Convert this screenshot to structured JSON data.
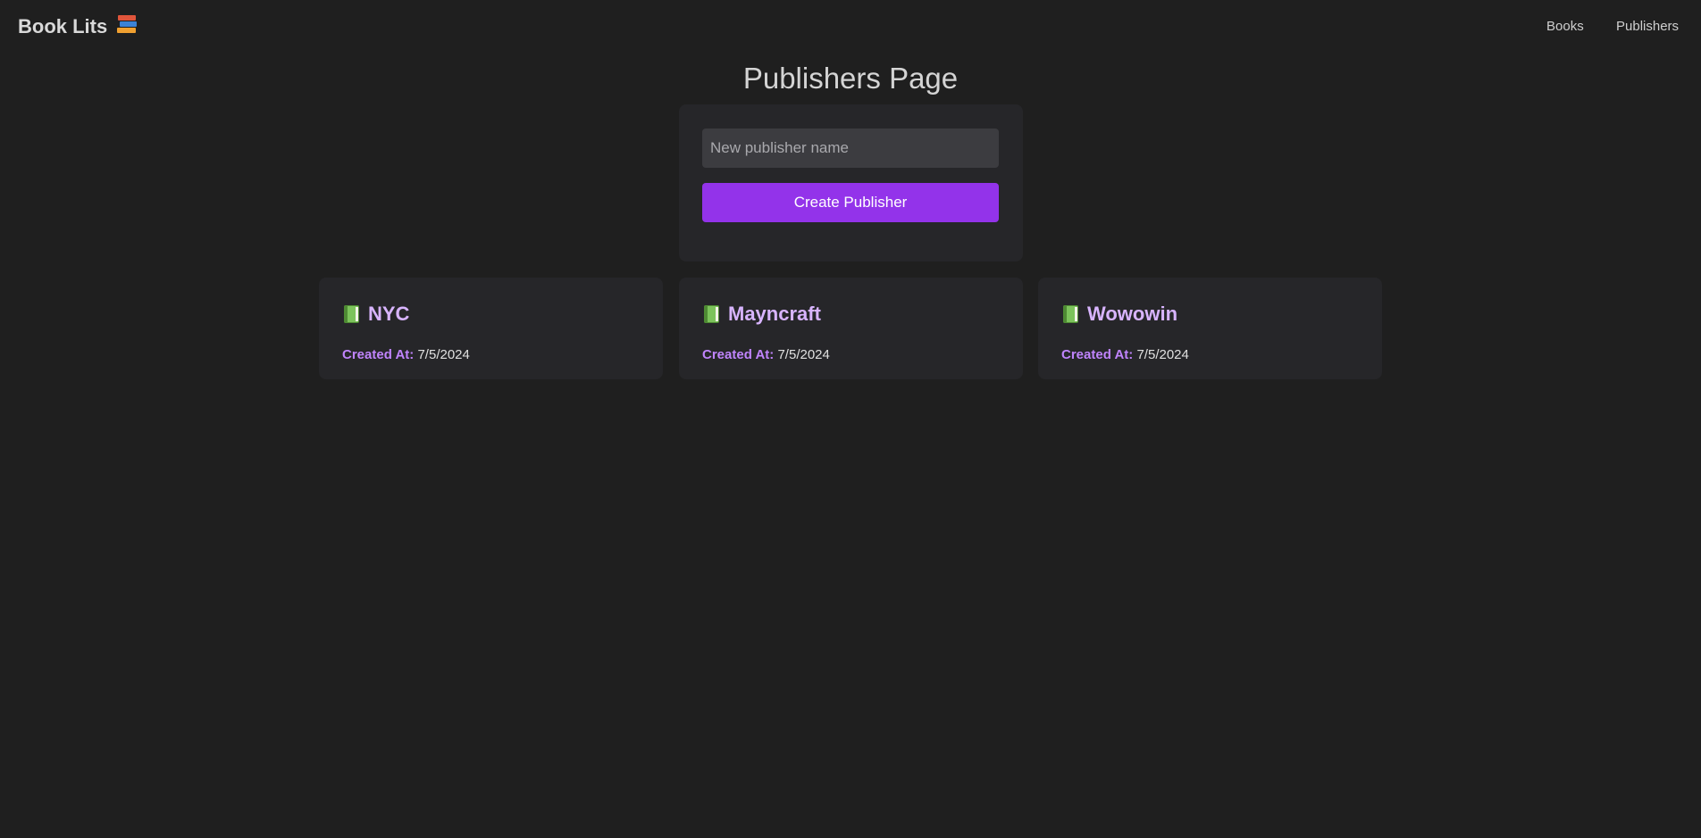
{
  "navbar": {
    "brand": "Book Lits",
    "brand_icon": "books-stack-icon",
    "links": [
      {
        "label": "Books"
      },
      {
        "label": "Publishers"
      }
    ]
  },
  "page": {
    "title": "Publishers Page"
  },
  "form": {
    "input_placeholder": "New publisher name",
    "input_value": "",
    "button_label": "Create Publisher"
  },
  "publishers": [
    {
      "icon": "green-book-icon",
      "name": "NYC",
      "created_label": "Created At:",
      "created_value": "7/5/2024"
    },
    {
      "icon": "green-book-icon",
      "name": "Mayncraft",
      "created_label": "Created At:",
      "created_value": "7/5/2024"
    },
    {
      "icon": "green-book-icon",
      "name": "Wowowin",
      "created_label": "Created At:",
      "created_value": "7/5/2024"
    }
  ],
  "colors": {
    "background": "#1f1f1f",
    "card": "#262629",
    "accent": "#9333ea",
    "publisher_name": "#d8b4fe",
    "meta_label": "#c084fc"
  }
}
